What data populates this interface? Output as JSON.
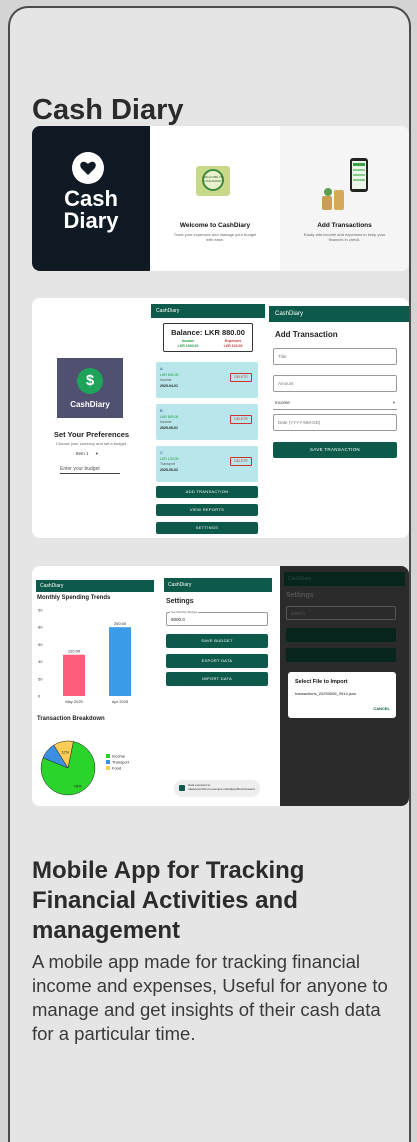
{
  "page": {
    "title": "Cash Diary",
    "heading": "Mobile App for Tracking Financial Activities and management",
    "description": "A mobile app made for tracking financial income and expenses, Useful for anyone to manage and get insights of their cash data for a particular time."
  },
  "colors": {
    "brand": "#0e5a4a",
    "card_bg": "#e5e5e5",
    "txn_bg": "#b8e6ea",
    "bar_may": "#ff5c7c",
    "bar_apr": "#3a9be8"
  },
  "onboarding": {
    "logo_line1": "Cash",
    "logo_line2": "Diary",
    "welcome_badge": "WELCOME TO CASHDIARY",
    "welcome_title": "Welcome to CashDiary",
    "welcome_text": "Track your expenses and manage your budget with ease.",
    "add_title": "Add Transactions",
    "add_text": "Easily add income and expenses to keep your finances in check."
  },
  "preferences": {
    "logo_text": "CashDiary",
    "logo_symbol": "$",
    "title": "Set Your Preferences",
    "subtitle": "Choose your currency and set a budget.",
    "currency_selected": "Item 1",
    "budget_placeholder": "Enter your budget"
  },
  "home": {
    "app_bar": "CashDiary",
    "balance": "Balance: LKR 880.00",
    "income_label": "Income",
    "income_value": "LKR 1000.00",
    "expenses_label": "Expenses",
    "expenses_value": "LKR 120.00",
    "transactions": [
      {
        "name": "A",
        "amount": "LKR 500.00",
        "category": "Income",
        "date": "2025-04-01",
        "delete": "DELETE"
      },
      {
        "name": "B",
        "amount": "LKR 500.00",
        "category": "Income",
        "date": "2025-05-01",
        "delete": "DELETE"
      },
      {
        "name": "C",
        "amount": "LKR 120.00",
        "category": "Transport",
        "date": "2025-05-02",
        "delete": "DELETE"
      }
    ],
    "buttons": [
      "ADD TRANSACTION",
      "VIEW REPORTS",
      "SETTINGS"
    ]
  },
  "add_transaction": {
    "app_bar": "CashDiary",
    "title": "Add Transaction",
    "title_placeholder": "Title",
    "amount_placeholder": "Amount",
    "category_selected": "Income",
    "date_placeholder": "Date (YYYY-MM-DD)",
    "save_button": "SAVE TRANSACTION"
  },
  "reports": {
    "app_bar": "CashDiary",
    "chart_title": "Monthly Spending Trends",
    "breakdown_title": "Transaction Breakdown",
    "pie_label_food": "12%",
    "pie_label_income": "78%",
    "legend": [
      "Income",
      "Transport",
      "Food"
    ]
  },
  "settings": {
    "app_bar": "CashDiary",
    "title": "Settings",
    "budget_label": "Set Monthly Budget",
    "budget_value": "5000.0",
    "buttons": [
      "SAVE BUDGET",
      "EXPORT DATA",
      "IMPORT DATA"
    ],
    "toast": "Data exported to: /data/user/0/com.example.cashdiary/files/transacti..."
  },
  "import_dialog": {
    "app_bar": "CashDiary",
    "title": "Settings",
    "budget_value": "5000.0",
    "dialog_title": "Select File to Import",
    "file_name": "transactions_20250506_0914.json",
    "cancel": "CANCEL"
  },
  "chart_data": [
    {
      "type": "bar",
      "title": "Monthly Spending Trends",
      "categories": [
        "May 2025",
        "Apr 2025"
      ],
      "values": [
        120.0,
        200.0
      ],
      "value_labels": [
        "120.00",
        "200.00"
      ],
      "y_tick_labels": [
        "0",
        "50",
        "30",
        "50",
        "80",
        "50"
      ],
      "ylim": [
        0,
        250
      ]
    },
    {
      "type": "pie",
      "title": "Transaction Breakdown",
      "categories": [
        "Income",
        "Transport",
        "Food"
      ],
      "values": [
        78,
        10,
        12
      ],
      "colors": [
        "#2bd42b",
        "#3a8fe0",
        "#ffcc55"
      ]
    }
  ]
}
